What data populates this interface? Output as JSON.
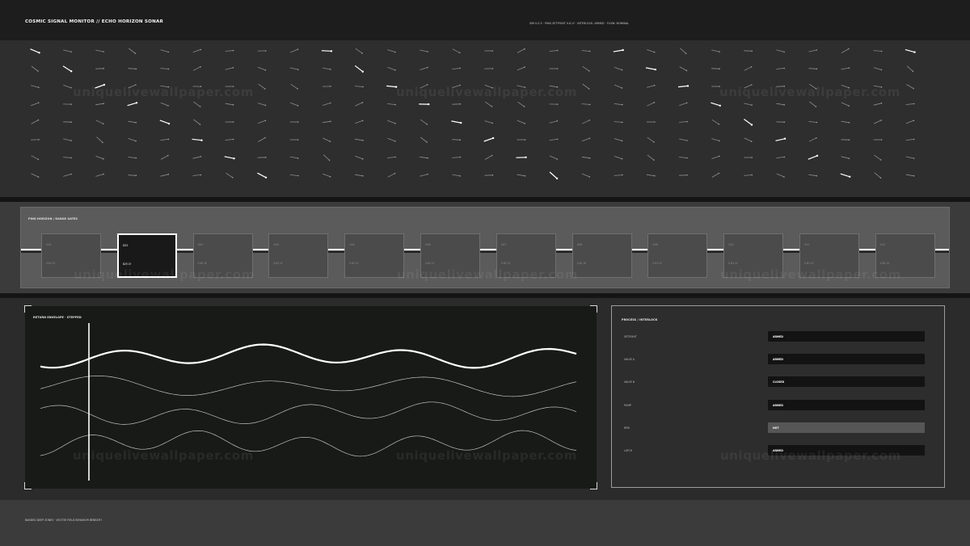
{
  "header": {
    "title": "COSMIC SIGNAL MONITOR // ECHO HORIZON SONAR",
    "status": "SIM 0.0.5 · PING SETPOINT 0.8 LY · INTERLOCK: ARMED · FLOW: NOMINAL"
  },
  "watermark": "uniquelivewallpaper.com",
  "ring": {
    "title": "PING HORIZON / RANGE GATES",
    "cards": [
      {
        "name": "G01",
        "value": "0.81 LY",
        "active": false
      },
      {
        "name": "G02",
        "value": "825 LY",
        "active": true
      },
      {
        "name": "G03",
        "value": "0.81 LY",
        "active": false
      },
      {
        "name": "G04",
        "value": "0.81 LY",
        "active": false
      },
      {
        "name": "G05",
        "value": "0.81 LY",
        "active": false
      },
      {
        "name": "G06",
        "value": "0.81 LY",
        "active": false
      },
      {
        "name": "G07",
        "value": "0.81 LY",
        "active": false
      },
      {
        "name": "G08",
        "value": "0.81 LY",
        "active": false
      },
      {
        "name": "G09",
        "value": "0.81 LY",
        "active": false
      },
      {
        "name": "G10",
        "value": "0.81 LY",
        "active": false
      },
      {
        "name": "G11",
        "value": "0.81 LY",
        "active": false
      },
      {
        "name": "G12",
        "value": "0.81 LY",
        "active": false
      }
    ]
  },
  "envelope": {
    "title": "RETURN ENVELOPE · STEPPED"
  },
  "process": {
    "title": "PROCESS / INTERLOCK",
    "rows": [
      {
        "label": "SETPOINT",
        "state": "ARMED",
        "highlight": false
      },
      {
        "label": "VALVE A",
        "state": "ARMED",
        "highlight": false
      },
      {
        "label": "VALVE B",
        "state": "CLOSED",
        "highlight": false
      },
      {
        "label": "PUMP",
        "state": "ARMED",
        "highlight": false
      },
      {
        "label": "RPM",
        "state": "HOT",
        "highlight": true
      },
      {
        "label": "LATCH",
        "state": "ARMED",
        "highlight": false
      }
    ]
  },
  "footer": {
    "text": "BANDED DEEP ZONES · VECTOR FIELD BEHAVIOR BENEATH"
  },
  "colors": {
    "accent": "#ffffff",
    "panel_dark": "#181a18",
    "ring_panel": "#5a5b5a"
  }
}
